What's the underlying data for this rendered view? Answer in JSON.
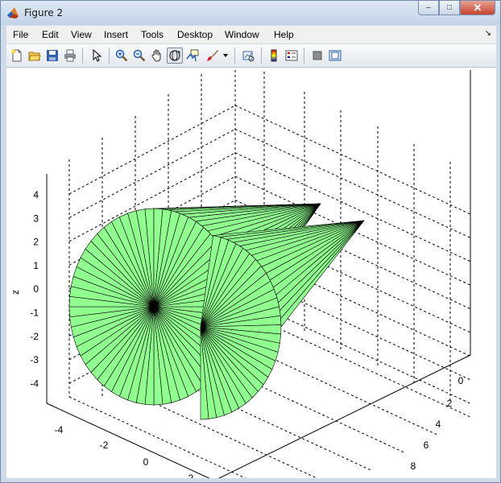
{
  "window": {
    "title": "Figure 2"
  },
  "titlebar_buttons": {
    "minimize": "–",
    "maximize": "□",
    "close": "✕"
  },
  "menu": [
    {
      "id": "file",
      "label": "File"
    },
    {
      "id": "edit",
      "label": "Edit"
    },
    {
      "id": "view",
      "label": "View"
    },
    {
      "id": "insert",
      "label": "Insert"
    },
    {
      "id": "tools",
      "label": "Tools"
    },
    {
      "id": "desktop",
      "label": "Desktop"
    },
    {
      "id": "window",
      "label": "Window"
    },
    {
      "id": "help",
      "label": "Help"
    }
  ],
  "toolbar": [
    {
      "id": "new-figure",
      "icon": "new-file-icon"
    },
    {
      "id": "open-file",
      "icon": "folder-open-icon"
    },
    {
      "id": "save-figure",
      "icon": "save-icon"
    },
    {
      "id": "print-figure",
      "icon": "print-icon"
    },
    {
      "id": "edit-plot",
      "icon": "pointer-arrow-icon"
    },
    {
      "id": "zoom-in",
      "icon": "zoom-in-icon"
    },
    {
      "id": "zoom-out",
      "icon": "zoom-out-icon"
    },
    {
      "id": "pan",
      "icon": "hand-pan-icon"
    },
    {
      "id": "rotate-3d",
      "icon": "rotate-3d-icon",
      "active": true
    },
    {
      "id": "data-cursor",
      "icon": "data-cursor-icon"
    },
    {
      "id": "brush",
      "icon": "brush-icon"
    },
    {
      "id": "link-plot",
      "icon": "link-plot-icon"
    },
    {
      "id": "insert-colorbar",
      "icon": "colorbar-icon"
    },
    {
      "id": "insert-legend",
      "icon": "legend-icon"
    },
    {
      "id": "hide-plot-tools",
      "icon": "hide-plot-tools-icon"
    },
    {
      "id": "show-plot-tools",
      "icon": "show-plot-tools-icon"
    }
  ],
  "plot": {
    "type": "3d-surface",
    "zlabel": "z",
    "z_ticks": [
      "4",
      "3",
      "2",
      "1",
      "0",
      "-1",
      "-2",
      "-3",
      "-4"
    ],
    "x_ticks": [
      "-4",
      "-2",
      "0",
      "2"
    ],
    "y_ticks": [
      "0",
      "2",
      "4",
      "6",
      "8"
    ],
    "surface_color": "#90ff90",
    "edge_color": "#000000",
    "grid": "on",
    "objects": [
      {
        "name": "cone-large",
        "shape": "cone with apex, circular base"
      },
      {
        "name": "cone-small",
        "shape": "cone with apex, half-circle base"
      }
    ]
  }
}
